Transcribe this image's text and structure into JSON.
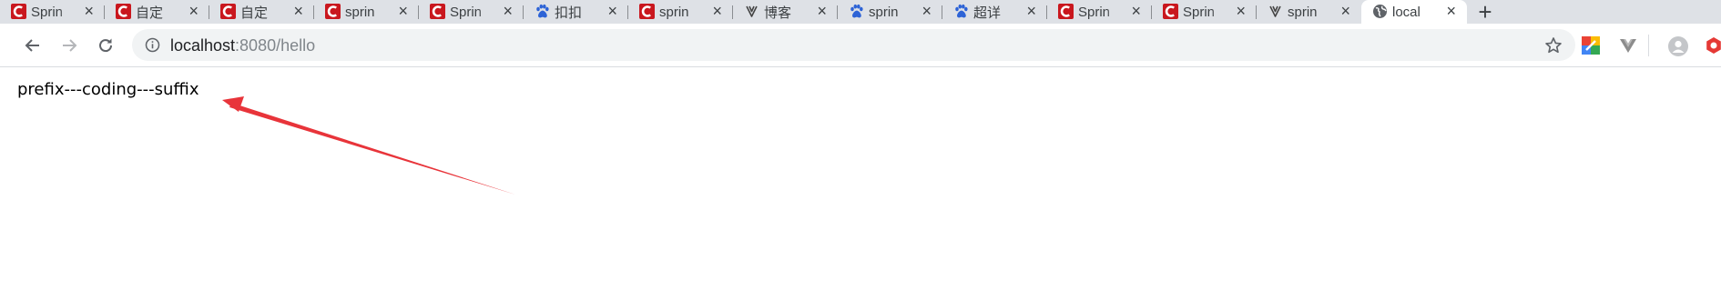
{
  "browser": {
    "tabs": [
      {
        "title": "Sprin",
        "favicon": "csdn-icon"
      },
      {
        "title": "自定",
        "favicon": "csdn-icon"
      },
      {
        "title": "自定",
        "favicon": "csdn-icon"
      },
      {
        "title": "sprin",
        "favicon": "csdn-icon"
      },
      {
        "title": "Sprin",
        "favicon": "csdn-icon"
      },
      {
        "title": "扣扣",
        "favicon": "baidu-paw-icon"
      },
      {
        "title": "sprin",
        "favicon": "csdn-icon"
      },
      {
        "title": "博客",
        "favicon": "cnblogs-icon"
      },
      {
        "title": "sprin",
        "favicon": "baidu-paw-icon"
      },
      {
        "title": "超详",
        "favicon": "baidu-paw-icon"
      },
      {
        "title": "Sprin",
        "favicon": "csdn-icon"
      },
      {
        "title": "Sprin",
        "favicon": "csdn-icon"
      },
      {
        "title": "sprin",
        "favicon": "cnblogs-icon"
      },
      {
        "title": "local",
        "favicon": "globe-icon",
        "active": true
      }
    ],
    "close_glyph": "×",
    "new_tab_glyph": "+",
    "url": {
      "host": "localhost",
      "rest": ":8080/hello"
    }
  },
  "page": {
    "text": "prefix---coding---suffix"
  },
  "colors": {
    "tabstrip": "#dee1e6",
    "csdn_red": "#c9171e",
    "baidu_blue": "#2d63d6",
    "annotation_arrow": "#e8343a"
  }
}
